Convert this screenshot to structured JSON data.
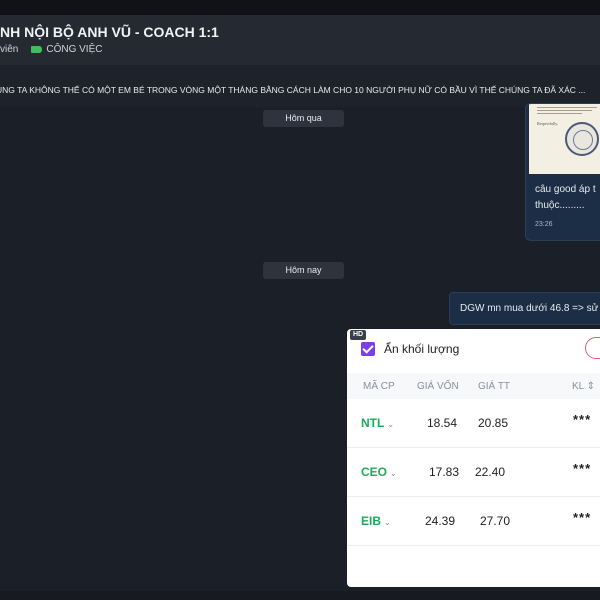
{
  "header": {
    "title": "NH NỘI BỘ ANH VŨ - COACH 1:1",
    "members": "viên",
    "tag": "CÔNG VIỆC"
  },
  "pinned": {
    "text": "ÚNG TA KHÔNG THỂ CÓ MỘT EM BÉ TRONG VÒNG MỘT THÁNG BẰNG CÁCH LÀM CHO 10 NGƯỜI PHỤ NỮ CÓ BẦU VÌ THẾ CHÚNG TA ĐÃ XÁC ..."
  },
  "dividers": {
    "yesterday": "Hôm qua",
    "today": "Hôm nay"
  },
  "image_message": {
    "doc_text": "Respectfully,",
    "text_line1": "câu good áp t",
    "text_line2": "thuộc.........",
    "time": "23:26"
  },
  "text_message": {
    "text": "DGW mn mua dưới 46.8 => sử"
  },
  "portfolio_card": {
    "hd_badge": "HD",
    "checkbox_label": "Ẩn khối lượng",
    "checkbox_checked": true,
    "columns": [
      "MÃ CP",
      "GIÁ VỐN",
      "GIÁ TT",
      "KL ⇕"
    ],
    "rows": [
      {
        "code": "NTL",
        "cost": "18.54",
        "price": "20.85",
        "volume": "***"
      },
      {
        "code": "CEO",
        "cost": "17.83",
        "price": "22.40",
        "volume": "***"
      },
      {
        "code": "EIB",
        "cost": "24.39",
        "price": "27.70",
        "volume": "***"
      }
    ],
    "code_color": "#1faa59",
    "accent": "#7b3fe4"
  }
}
